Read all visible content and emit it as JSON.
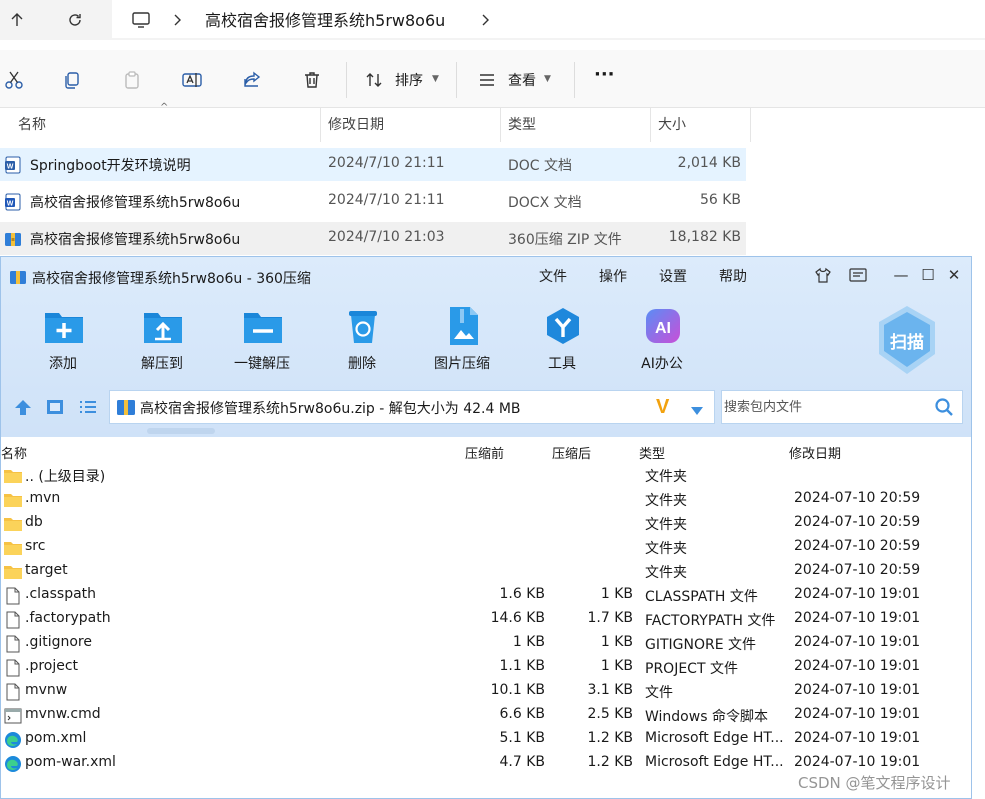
{
  "explorer": {
    "nav": {
      "back_icon": "arrow-up-icon",
      "refresh_icon": "refresh-icon"
    },
    "breadcrumb": {
      "monitor_icon": "monitor-icon",
      "title": "高校宿舍报修管理系统h5rw8o6u"
    },
    "commands": {
      "sort_label": "排序",
      "view_label": "查看",
      "more_label": "···"
    },
    "columns": {
      "name": "名称",
      "date": "修改日期",
      "type": "类型",
      "size": "大小"
    },
    "files": [
      {
        "name": "Springboot开发环境说明",
        "date": "2024/7/10 21:11",
        "type": "DOC 文档",
        "size": "2,014 KB"
      },
      {
        "name": "高校宿舍报修管理系统h5rw8o6u",
        "date": "2024/7/10 21:11",
        "type": "DOCX 文档",
        "size": "56 KB"
      },
      {
        "name": "高校宿舍报修管理系统h5rw8o6u",
        "date": "2024/7/10 21:03",
        "type": "360压缩 ZIP 文件",
        "size": "18,182 KB"
      }
    ]
  },
  "zip": {
    "title": "高校宿舍报修管理系统h5rw8o6u - 360压缩",
    "menu": [
      "文件",
      "操作",
      "设置",
      "帮助"
    ],
    "window_controls": {
      "minimize": "—",
      "maximize": "☐",
      "close": "✕"
    },
    "tools": [
      "添加",
      "解压到",
      "一键解压",
      "删除",
      "图片压缩",
      "工具",
      "AI办公"
    ],
    "scan_label": "扫描",
    "address": "高校宿舍报修管理系统h5rw8o6u.zip - 解包大小为 42.4 MB",
    "search_placeholder": "搜索包内文件",
    "columns": {
      "name": "名称",
      "before": "压缩前",
      "after": "压缩后",
      "type": "类型",
      "date": "修改日期"
    },
    "rows": [
      {
        "name": ".. (上级目录)",
        "before": "",
        "after": "",
        "type": "文件夹",
        "date": "",
        "icon": "folder-icon"
      },
      {
        "name": ".mvn",
        "before": "",
        "after": "",
        "type": "文件夹",
        "date": "2024-07-10 20:59",
        "icon": "folder-icon"
      },
      {
        "name": "db",
        "before": "",
        "after": "",
        "type": "文件夹",
        "date": "2024-07-10 20:59",
        "icon": "folder-icon"
      },
      {
        "name": "src",
        "before": "",
        "after": "",
        "type": "文件夹",
        "date": "2024-07-10 20:59",
        "icon": "folder-icon"
      },
      {
        "name": "target",
        "before": "",
        "after": "",
        "type": "文件夹",
        "date": "2024-07-10 20:59",
        "icon": "folder-icon"
      },
      {
        "name": ".classpath",
        "before": "1.6 KB",
        "after": "1 KB",
        "type": "CLASSPATH 文件",
        "date": "2024-07-10 19:01",
        "icon": "file-icon"
      },
      {
        "name": ".factorypath",
        "before": "14.6 KB",
        "after": "1.7 KB",
        "type": "FACTORYPATH 文件",
        "date": "2024-07-10 19:01",
        "icon": "file-icon"
      },
      {
        "name": ".gitignore",
        "before": "1 KB",
        "after": "1 KB",
        "type": "GITIGNORE 文件",
        "date": "2024-07-10 19:01",
        "icon": "file-icon"
      },
      {
        "name": ".project",
        "before": "1.1 KB",
        "after": "1 KB",
        "type": "PROJECT 文件",
        "date": "2024-07-10 19:01",
        "icon": "file-icon"
      },
      {
        "name": "mvnw",
        "before": "10.1 KB",
        "after": "3.1 KB",
        "type": "文件",
        "date": "2024-07-10 19:01",
        "icon": "file-icon"
      },
      {
        "name": "mvnw.cmd",
        "before": "6.6 KB",
        "after": "2.5 KB",
        "type": "Windows 命令脚本",
        "date": "2024-07-10 19:01",
        "icon": "cmd-icon"
      },
      {
        "name": "pom.xml",
        "before": "5.1 KB",
        "after": "1.2 KB",
        "type": "Microsoft Edge HT...",
        "date": "2024-07-10 19:01",
        "icon": "edge-icon"
      },
      {
        "name": "pom-war.xml",
        "before": "4.7 KB",
        "after": "1.2 KB",
        "type": "Microsoft Edge HT...",
        "date": "2024-07-10 19:01",
        "icon": "edge-icon"
      }
    ]
  },
  "watermark": "CSDN @笔文程序设计"
}
